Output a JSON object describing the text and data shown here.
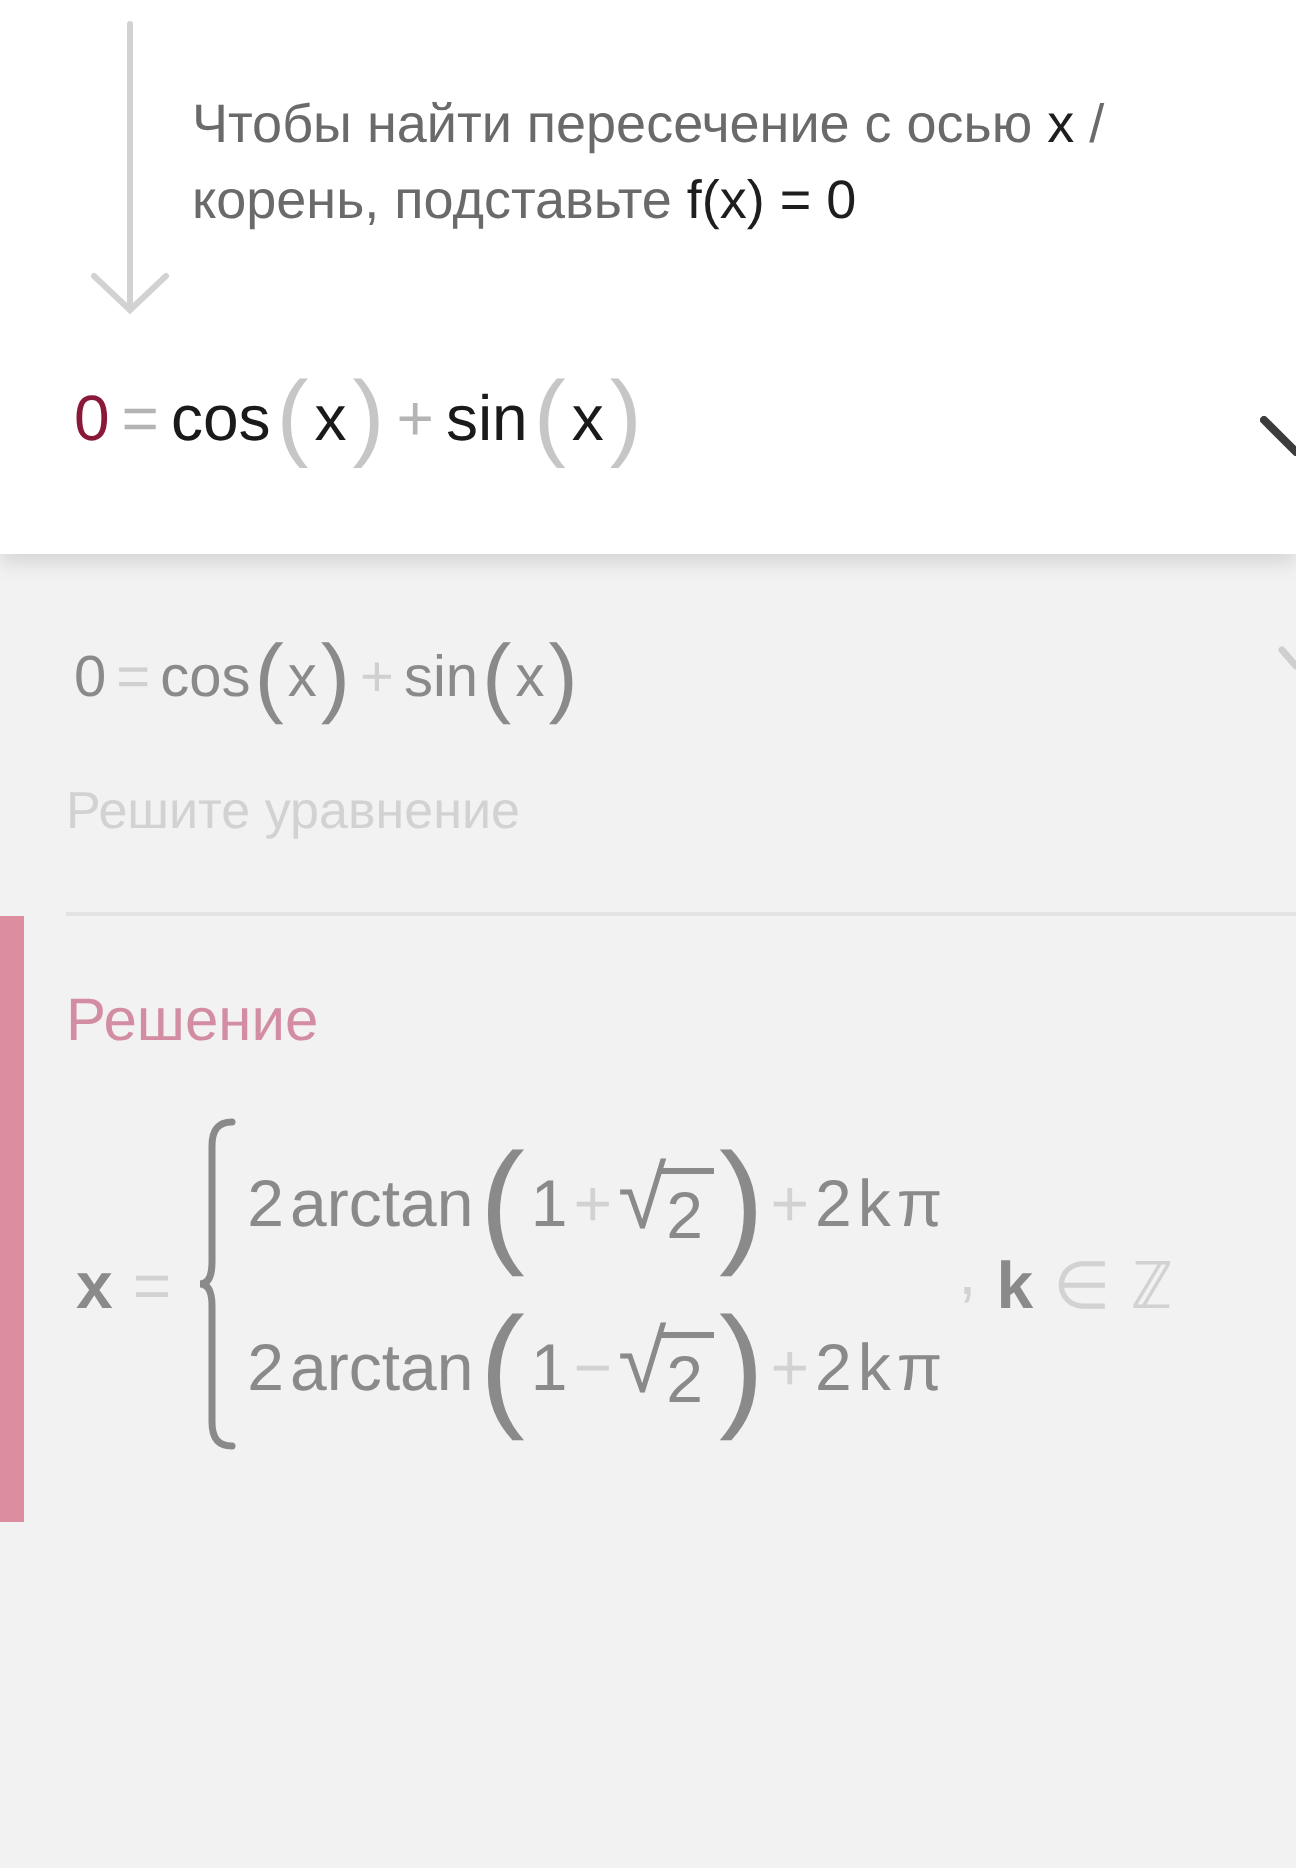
{
  "step": {
    "hint": "Чтобы найти пересечение с осью **x** / корень, подставьте **f(x) = 0**",
    "equation": [
      {
        "text": "0",
        "kind": "accent"
      },
      {
        "text": "=",
        "kind": "op"
      },
      {
        "text": "cos",
        "kind": "fn"
      },
      {
        "text": "(",
        "kind": "paren"
      },
      {
        "text": "x",
        "kind": "var"
      },
      {
        "text": ")",
        "kind": "paren"
      },
      {
        "text": "+",
        "kind": "op"
      },
      {
        "text": "sin",
        "kind": "fn"
      },
      {
        "text": "(",
        "kind": "paren"
      },
      {
        "text": "x",
        "kind": "var"
      },
      {
        "text": ")",
        "kind": "paren"
      }
    ]
  },
  "previous_step": {
    "equation": [
      {
        "text": "0",
        "kind": "num"
      },
      {
        "text": "=",
        "kind": "op"
      },
      {
        "text": "cos",
        "kind": "fn"
      },
      {
        "text": "(",
        "kind": "paren"
      },
      {
        "text": "x",
        "kind": "var"
      },
      {
        "text": ")",
        "kind": "paren"
      },
      {
        "text": "+",
        "kind": "op"
      },
      {
        "text": "sin",
        "kind": "fn"
      },
      {
        "text": "(",
        "kind": "paren"
      },
      {
        "text": "x",
        "kind": "var"
      },
      {
        "text": ")",
        "kind": "paren"
      }
    ],
    "caption": "Решите уравнение"
  },
  "solution": {
    "title": "Решение",
    "lhs": [
      {
        "text": "x",
        "kind": "bold"
      },
      {
        "text": "=",
        "kind": "op"
      }
    ],
    "cases": [
      [
        {
          "text": "2",
          "kind": "num"
        },
        {
          "text": "arctan",
          "kind": "fn"
        },
        {
          "text": "(",
          "kind": "paren"
        },
        {
          "text": "1",
          "kind": "num"
        },
        {
          "text": "+",
          "kind": "op"
        },
        {
          "kind": "sqrt",
          "symbol": "√",
          "radicand": "2"
        },
        {
          "text": ")",
          "kind": "paren"
        },
        {
          "text": "+",
          "kind": "op"
        },
        {
          "text": "2",
          "kind": "num"
        },
        {
          "text": "k",
          "kind": "var"
        },
        {
          "text": "π",
          "kind": "var"
        }
      ],
      [
        {
          "text": "2",
          "kind": "num"
        },
        {
          "text": "arctan",
          "kind": "fn"
        },
        {
          "text": "(",
          "kind": "paren"
        },
        {
          "text": "1",
          "kind": "num"
        },
        {
          "text": "−",
          "kind": "op"
        },
        {
          "kind": "sqrt",
          "symbol": "√",
          "radicand": "2"
        },
        {
          "text": ")",
          "kind": "paren"
        },
        {
          "text": "+",
          "kind": "op"
        },
        {
          "text": "2",
          "kind": "num"
        },
        {
          "text": "k",
          "kind": "var"
        },
        {
          "text": "π",
          "kind": "var"
        }
      ]
    ],
    "suffix": [
      {
        "text": ",",
        "kind": "punct"
      },
      {
        "text": "k",
        "kind": "bold"
      },
      {
        "text": "∈",
        "kind": "op"
      },
      {
        "text": "ℤ",
        "kind": "op"
      }
    ]
  }
}
